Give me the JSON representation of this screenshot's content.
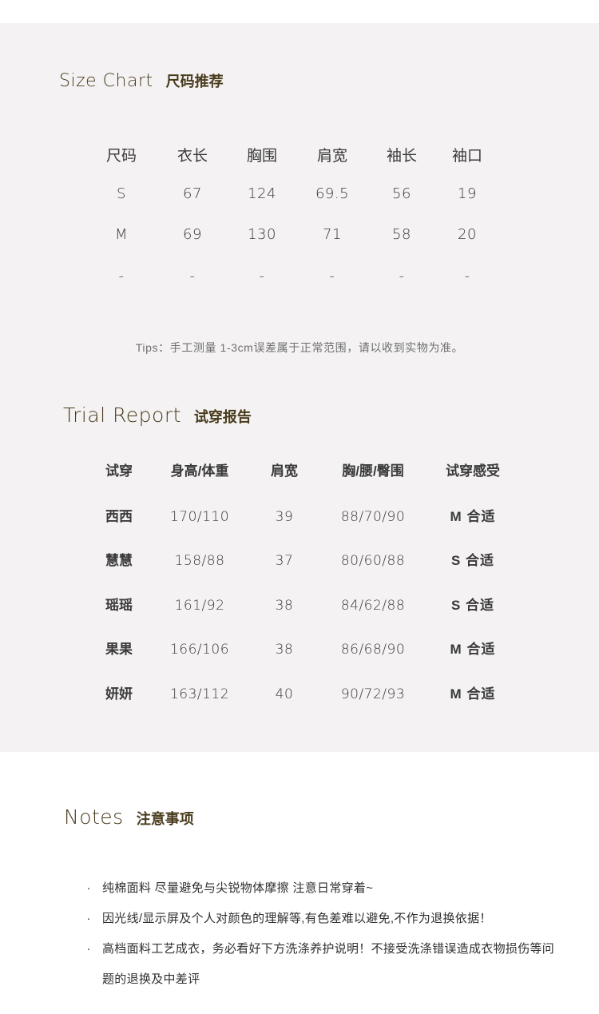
{
  "size_chart": {
    "title_en": "Size Chart",
    "title_zh": "尺码推荐",
    "headers": [
      "尺码",
      "衣长",
      "胸围",
      "肩宽",
      "袖长",
      "袖口"
    ],
    "rows": [
      [
        "S",
        "67",
        "124",
        "69.5",
        "56",
        "19"
      ],
      [
        "M",
        "69",
        "130",
        "71",
        "58",
        "20"
      ],
      [
        "-",
        "-",
        "-",
        "-",
        "-",
        "-"
      ]
    ],
    "tips": "Tips：手工测量 1-3cm误差属于正常范围，请以收到实物为准。"
  },
  "trial_report": {
    "title_en": "Trial Report",
    "title_zh": "试穿报告",
    "headers": [
      "试穿",
      "身高/体重",
      "肩宽",
      "胸/腰/臀围",
      "试穿感受"
    ],
    "rows": [
      [
        "西西",
        "170/110",
        "39",
        "88/70/90",
        "M 合适"
      ],
      [
        "慧慧",
        "158/88",
        "37",
        "80/60/88",
        "S 合适"
      ],
      [
        "瑶瑶",
        "161/92",
        "38",
        "84/62/88",
        "S 合适"
      ],
      [
        "果果",
        "166/106",
        "38",
        "86/68/90",
        "M 合适"
      ],
      [
        "妍妍",
        "163/112",
        "40",
        "90/72/93",
        "M 合适"
      ]
    ]
  },
  "notes": {
    "title_en": "Notes",
    "title_zh": "注意事项",
    "bullet": "·",
    "items": [
      "纯棉面料 尽量避免与尖锐物体摩擦 注意日常穿着~",
      "因光线/显示屏及个人对颜色的理解等,有色差难以避免,不作为退换依据！",
      "高档面料工艺成衣，务必看好下方洗涤养护说明！不接受洗涤错误造成衣物损伤等问题的退换及中差评"
    ]
  },
  "colors": {
    "panel_bg": "#f4f2f2",
    "title_color": "#4a3d1e",
    "text_color": "#3a3a3a"
  }
}
